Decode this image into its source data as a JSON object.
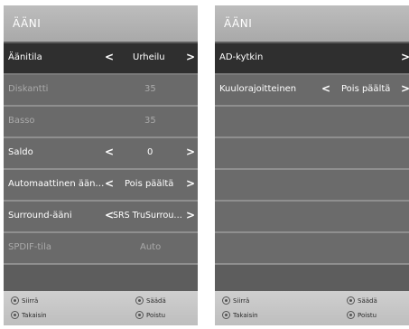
{
  "left_panel": {
    "title": "ÄÄNI",
    "rows": [
      {
        "label": "Äänitila",
        "value": "Urheilu"
      },
      {
        "label": "Diskantti",
        "value": "35"
      },
      {
        "label": "Basso",
        "value": "35"
      },
      {
        "label": "Saldo",
        "value": "0"
      },
      {
        "label": "Automaattinen ään…",
        "value": "Pois päältä"
      },
      {
        "label": "Surround-ääni",
        "value": "SRS TruSurrou…"
      },
      {
        "label": "SPDIF-tila",
        "value": "Auto"
      }
    ],
    "footer": {
      "move": "Siirrä",
      "adjust": "Säädä",
      "back": "Takaisin",
      "exit": "Poistu"
    }
  },
  "right_panel": {
    "title": "ÄÄNI",
    "rows": [
      {
        "label": "AD-kytkin",
        "value": ""
      },
      {
        "label": "Kuulorajoitteinen",
        "value": "Pois päältä"
      }
    ],
    "footer": {
      "move": "Siirrä",
      "adjust": "Säädä",
      "back": "Takaisin",
      "exit": "Poistu"
    }
  },
  "icons": {
    "prev": "chevron-left-icon",
    "next": "chevron-right-icon",
    "move": "nav-wheel-icon",
    "adjust": "ok-button-icon",
    "back": "back-button-icon",
    "exit": "exit-button-icon"
  },
  "colors": {
    "selected_row": "#2f2f2f",
    "row": "#6a6a6a",
    "disabled_text": "#a9a9a9",
    "header": "#b3b3b3",
    "footer": "#c6c6c6"
  }
}
